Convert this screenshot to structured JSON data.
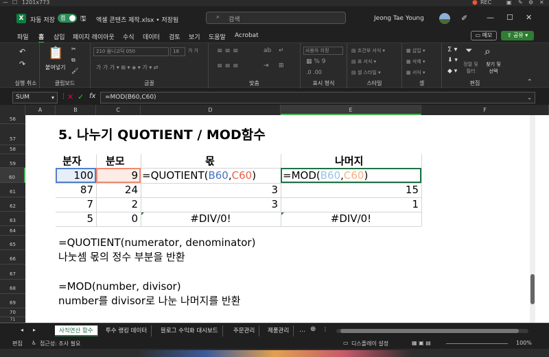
{
  "recorder": {
    "size": "1201x773",
    "rec": "REC"
  },
  "titlebar": {
    "autosave_label": "자동 저장",
    "autosave_state": "켬",
    "filename": "엑셀 콘텐츠 제작.xlsx • 저장됨",
    "search_placeholder": "검색",
    "user_name": "Jeong Tae Young"
  },
  "menu": {
    "tabs": [
      "파일",
      "홈",
      "삽입",
      "페이지 레이아웃",
      "수식",
      "데이터",
      "검토",
      "보기",
      "도움말",
      "Acrobat"
    ],
    "memo": "메모",
    "share": "공유"
  },
  "ribbon": {
    "undo_group": "실행 취소",
    "clipboard_group": "클립보드",
    "paste_label": "붙여넣기",
    "font_group": "글꼴",
    "font_name": "210 옴니고딕 050",
    "font_size": "18",
    "align_group": "맞춤",
    "number_group": "표시 형식",
    "number_format": "사용자 지정",
    "style_group": "스타일",
    "style_items": [
      "조건부 서식",
      "표 서식",
      "셀 스타일"
    ],
    "cells_group": "셀",
    "cells_items": [
      "삽입",
      "삭제",
      "서식"
    ],
    "edit_group": "편집",
    "sort_label": "정렬 및 필터",
    "find_label": "찾기 및 선택"
  },
  "formula_bar": {
    "name_box": "SUM",
    "fx": "fx",
    "formula": "=MOD(B60,C60)"
  },
  "columns": [
    "A",
    "B",
    "C",
    "D",
    "E",
    "F"
  ],
  "rows": [
    "56",
    "57",
    "58",
    "59",
    "60",
    "61",
    "62",
    "63",
    "64",
    "65",
    "66",
    "67",
    "68",
    "69",
    "70",
    "71"
  ],
  "sheet": {
    "title": "5. 나누기 QUOTIENT / MOD함수",
    "h_numerator": "분자",
    "h_denominator": "분모",
    "h_quotient": "몫",
    "h_remainder": "나머지",
    "r60_b": "100",
    "r60_c": "9",
    "r60_d": {
      "pre": "=QUOTIENT(",
      "a1": "B60",
      "sep": ",",
      "a2": "C60",
      "post": ")"
    },
    "r60_e": {
      "pre": "=MOD(",
      "a1": "B60",
      "sep": ",",
      "a2": "C60",
      "post": ")"
    },
    "r61": [
      "87",
      "24",
      "3",
      "15"
    ],
    "r62": [
      "7",
      "2",
      "3",
      "1"
    ],
    "r63": [
      "5",
      "0",
      "#DIV/0!",
      "#DIV/0!"
    ],
    "quot_syntax": "=QUOTIENT(numerator, denominator)",
    "quot_desc": "나눗셈 몫의 정수 부분을 반환",
    "mod_syntax": "=MOD(number, divisor)",
    "mod_desc": "number를 divisor로 나눈 나머지를 반환"
  },
  "sheet_tabs": [
    "사칙연산 함수",
    "투수 랭킹 데이터",
    "블로그 수익화 대시보드",
    "주문관리",
    "제품관리"
  ],
  "status": {
    "mode": "편집",
    "accessibility": "접근성: 조사 필요",
    "display": "디스플레이 설정",
    "zoom": "100%"
  },
  "colors": {
    "accent": "#217346",
    "ref_blue": "#4472c4",
    "ref_red": "#e8604c",
    "select_green": "#1e7145"
  }
}
